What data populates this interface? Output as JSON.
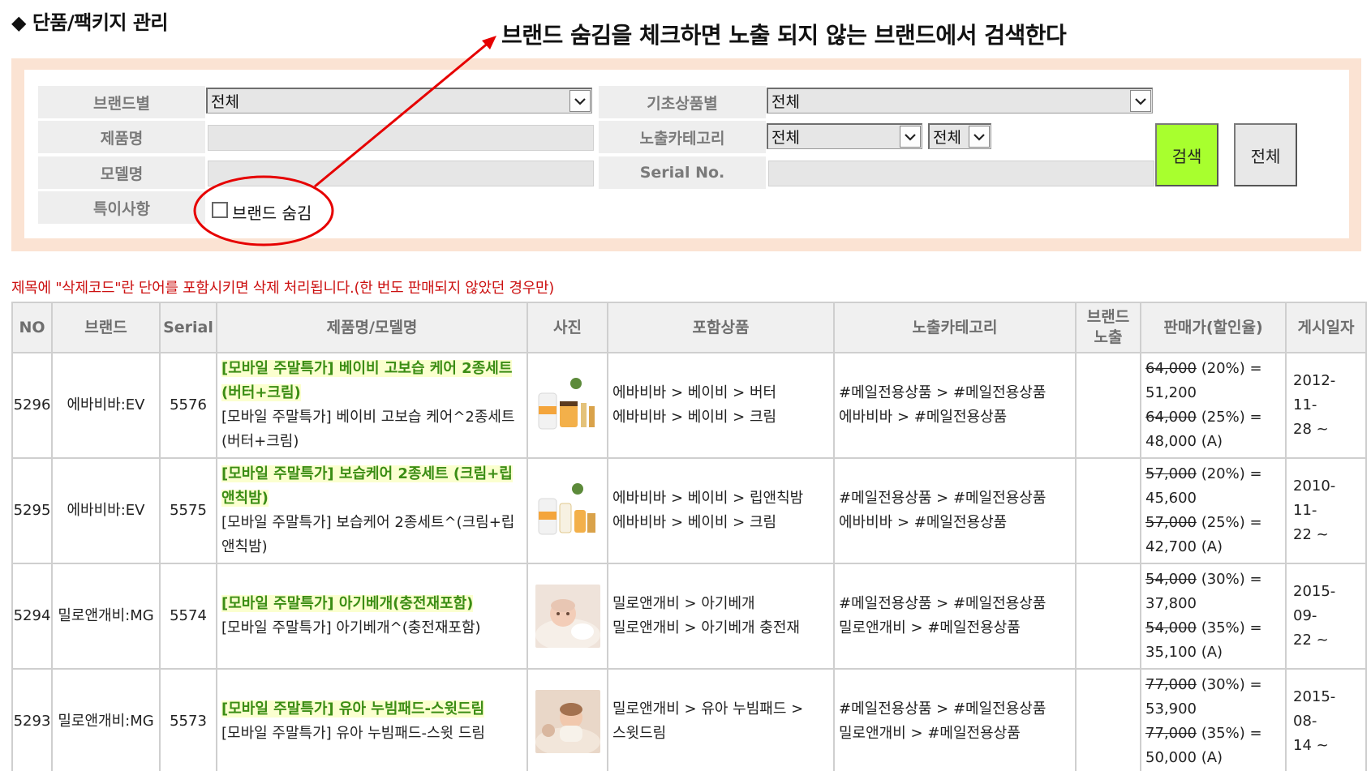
{
  "page": {
    "title": "◆ 단품/팩키지 관리",
    "annotation": "브랜드 숨김을 체크하면 노출 되지 않는 브랜드에서 검색한다"
  },
  "colors": {
    "panel_border": "#fbe3d3",
    "label_bg": "#eeeeee",
    "search_button": "#a8ff2e",
    "annotation_red": "#e60000",
    "product_name_green": "#3b8d14",
    "product_name_highlight": "#fbffcf",
    "notice_red": "#cc1111"
  },
  "filters": {
    "brand_label": "브랜드별",
    "brand_value": "전체",
    "base_product_label": "기초상품별",
    "base_product_value": "전체",
    "product_name_label": "제품명",
    "product_name_value": "",
    "exposure_category_label": "노출카테고리",
    "exposure_category_value1": "전체",
    "exposure_category_value2": "전체",
    "model_name_label": "모델명",
    "model_name_value": "",
    "serial_label": "Serial No.",
    "serial_value": "",
    "special_label": "특이사항",
    "hide_brand_label": "브랜드 숨김",
    "hide_brand_checked": false
  },
  "buttons": {
    "search": "검색",
    "all": "전체"
  },
  "icons": {
    "select_arrow": "chevron-down-icon",
    "annotation_arrow": "arrow-icon",
    "annotation_circle": "circle-highlight"
  },
  "notice": "제목에 \"삭제코드\"란 단어를 포함시키면 삭제 처리됩니다.(한 번도 판매되지 않았던 경우만)",
  "table": {
    "headers": {
      "no": "NO",
      "brand": "브랜드",
      "serial": "Serial",
      "name": "제품명/모델명",
      "photo": "사진",
      "included": "포함상품",
      "category": "노출카테고리",
      "brand_exposure_1": "브랜드",
      "brand_exposure_2": "노출",
      "price": "판매가(할인율)",
      "posted": "게시일자"
    },
    "rows": [
      {
        "no": "5296",
        "brand": "에바비바:EV",
        "serial": "5576",
        "product_name": "[모바일 주말특가] 베이비 고보습 케어 2종세트 (버터+크림)",
        "model_name": "[모바일 주말특가] 베이비 고보습 케어^2종세트 (버터+크림)",
        "included": [
          "에바비바 > 베이비 > 버터",
          "에바비바 > 베이비 > 크림"
        ],
        "category": [
          "#메일전용상품 > #메일전용상품",
          "에바비바 > #메일전용상품"
        ],
        "brand_exposure": "",
        "price": [
          {
            "orig": "64,000",
            "rate": " (20%) =",
            "sale": "51,200"
          },
          {
            "orig": "64,000",
            "rate": " (25%) =",
            "sale": "48,000 (A)"
          }
        ],
        "posted_1": "2012-11-",
        "posted_2": "28 ~",
        "photo_desc": "cream-products"
      },
      {
        "no": "5295",
        "brand": "에바비바:EV",
        "serial": "5575",
        "product_name": "[모바일 주말특가] 보습케어 2종세트 (크림+립앤칙밤)",
        "model_name": "[모바일 주말특가] 보습케어 2종세트^(크림+립앤칙밤)",
        "included": [
          "에바비바 > 베이비 > 립앤칙밤",
          "에바비바 > 베이비 > 크림"
        ],
        "category": [
          "#메일전용상품 > #메일전용상품",
          "에바비바 > #메일전용상품"
        ],
        "brand_exposure": "",
        "price": [
          {
            "orig": "57,000",
            "rate": " (20%) =",
            "sale": "45,600"
          },
          {
            "orig": "57,000",
            "rate": " (25%) =",
            "sale": "42,700 (A)"
          }
        ],
        "posted_1": "2010-11-",
        "posted_2": "22 ~",
        "photo_desc": "cream-products"
      },
      {
        "no": "5294",
        "brand": "밀로앤개비:MG",
        "serial": "5574",
        "product_name": "[모바일 주말특가] 아기베개(충전재포함)",
        "model_name": "[모바일 주말특가] 아기베개^(충전재포함)",
        "included": [
          "밀로앤개비 > 아기베개",
          "밀로앤개비 > 아기베개 충전재"
        ],
        "category": [
          "#메일전용상품 > #메일전용상품",
          "밀로앤개비 > #메일전용상품"
        ],
        "brand_exposure": "",
        "price": [
          {
            "orig": "54,000",
            "rate": " (30%) =",
            "sale": "37,800"
          },
          {
            "orig": "54,000",
            "rate": " (35%) =",
            "sale": "35,100 (A)"
          }
        ],
        "posted_1": "2015-09-",
        "posted_2": "22 ~",
        "photo_desc": "baby-photo"
      },
      {
        "no": "5293",
        "brand": "밀로앤개비:MG",
        "serial": "5573",
        "product_name": "[모바일 주말특가] 유아 누빔패드-스윗드림",
        "model_name": "[모바일 주말특가] 유아 누빔패드-스윗 드림",
        "included": [
          "밀로앤개비 > 유아 누빔패드 >",
          "스윗드림"
        ],
        "category": [
          "#메일전용상품 > #메일전용상품",
          "밀로앤개비 > #메일전용상품"
        ],
        "brand_exposure": "",
        "price": [
          {
            "orig": "77,000",
            "rate": " (30%) =",
            "sale": "53,900"
          },
          {
            "orig": "77,000",
            "rate": " (35%) =",
            "sale": "50,000 (A)"
          }
        ],
        "posted_1": "2015-08-",
        "posted_2": "14 ~",
        "photo_desc": "baby-photo"
      }
    ]
  }
}
